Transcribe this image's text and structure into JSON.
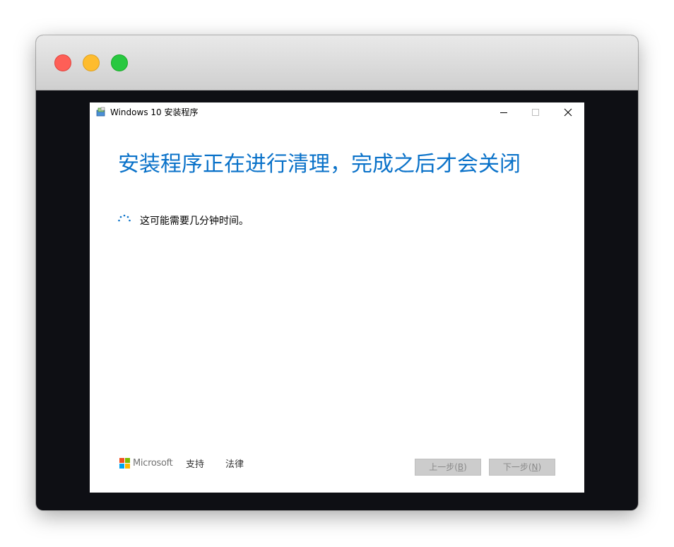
{
  "setup": {
    "title": "Windows 10 安装程序",
    "heading": "安装程序正在进行清理，完成之后才会关闭",
    "status": "这可能需要几分钟时间。"
  },
  "footer": {
    "brand": "Microsoft",
    "support": "支持",
    "legal": "法律",
    "back": {
      "pre": "上一步(",
      "key": "B",
      "post": ")"
    },
    "next": {
      "pre": "下一步(",
      "key": "N",
      "post": ")"
    }
  },
  "icons": [
    "setup-app-icon",
    "minimize-icon",
    "maximize-icon",
    "close-icon",
    "loading-spinner-icon",
    "microsoft-logo-icon"
  ],
  "colors": {
    "heading": "#0a72c9",
    "ms_red": "#f25022",
    "ms_green": "#7fba00",
    "ms_blue": "#00a4ef",
    "ms_yellow": "#ffb900"
  }
}
